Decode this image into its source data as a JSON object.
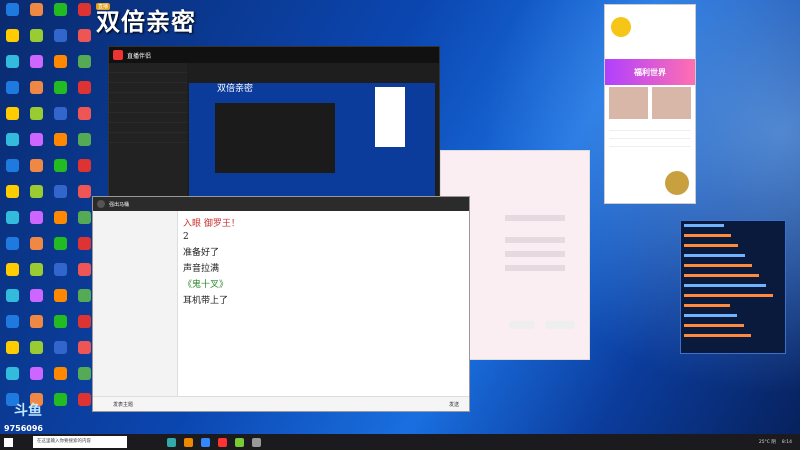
{
  "overlay": {
    "title": "双倍亲密",
    "badge": "直播",
    "streamer_id": "9756096",
    "logo_text": "斗鱼"
  },
  "main_window": {
    "app_name": "直播伴侣",
    "preview_title": "双倍亲密"
  },
  "chat_window": {
    "header_text": "强出马桶",
    "messages": [
      {
        "meta": "",
        "text": "入眼 御罗王！"
      },
      {
        "meta": "",
        "text": "2"
      },
      {
        "meta": "",
        "text": "准备好了"
      },
      {
        "meta": "",
        "text": "声音拉满"
      },
      {
        "meta": "",
        "text": "《鬼十叉》"
      },
      {
        "meta": "",
        "text": "耳机带上了"
      }
    ],
    "bottom_label_1": "发表主题",
    "bottom_label_2": "发送"
  },
  "pink_panel": {
    "title": "",
    "placeholder": ""
  },
  "gift_widget": {
    "banner": "福利世界"
  },
  "taskbar": {
    "search_placeholder": "在这里输入你要搜索的内容",
    "weather": "25°C 阴",
    "time": "8:14"
  },
  "colors": {
    "accent": "#0b46b0",
    "banner": "#b040ff"
  }
}
